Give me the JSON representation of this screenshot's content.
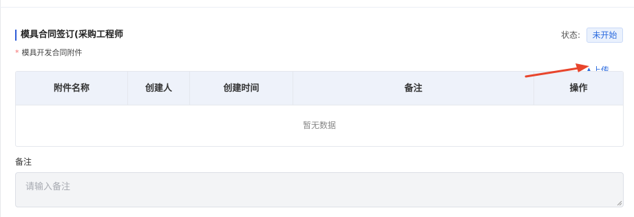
{
  "section": {
    "title": "模具合同签订(采购工程师",
    "status_label": "状态:",
    "status_value": "未开始"
  },
  "attachment": {
    "required_mark": "*",
    "label": "模具开发合同附件",
    "upload_label": "上传"
  },
  "table": {
    "columns": [
      "附件名称",
      "创建人",
      "创建时间",
      "备注",
      "操作"
    ],
    "empty_text": "暂无数据"
  },
  "remark": {
    "label": "备注",
    "placeholder": "请输入备注",
    "value": ""
  },
  "colors": {
    "accent": "#2d6cdf",
    "header_bg": "#eef2fa",
    "required": "#f56c6c",
    "annotation_arrow": "#e8452c"
  },
  "icons": {
    "upload": "upload-icon",
    "annotation": "red-arrow-icon"
  }
}
